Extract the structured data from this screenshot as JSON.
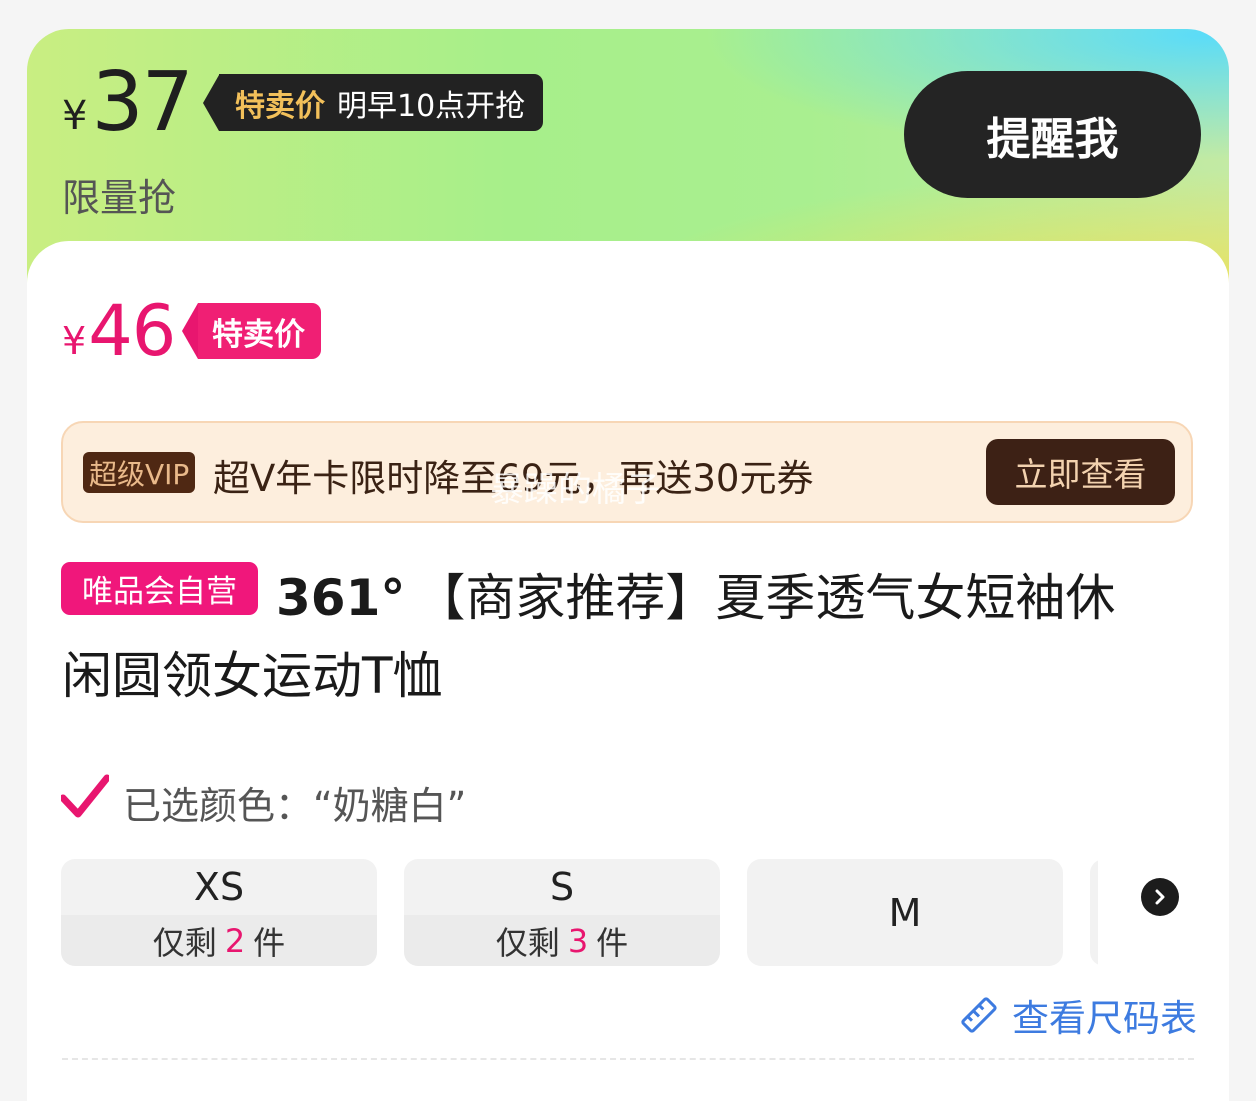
{
  "flash_sale": {
    "currency": "¥",
    "price": "37",
    "tag_label": "特卖价",
    "tag_time": "明早10点开抢",
    "subtitle": "限量抢",
    "remind_button": "提醒我"
  },
  "current_price": {
    "currency": "¥",
    "price": "46",
    "tag_label": "特卖价"
  },
  "vip_banner": {
    "badge": "超级VIP",
    "text": "超V年卡限时降至69元，再送30元券",
    "button": "立即查看"
  },
  "watermark": "暴躁的橘子",
  "product": {
    "shop_badge": "唯品会自营",
    "brand": "361°",
    "title_line1": "【商家推荐】夏季透气女短袖休",
    "title_line2": "闲圆领女运动T恤"
  },
  "selection": {
    "selected_color": "已选颜色：“奶糖白”"
  },
  "sizes": [
    {
      "label": "XS",
      "stock_prefix": "仅剩",
      "stock": "2",
      "stock_suffix": "件"
    },
    {
      "label": "S",
      "stock_prefix": "仅剩",
      "stock": "3",
      "stock_suffix": "件"
    },
    {
      "label": "M"
    }
  ],
  "size_chart_link": "查看尺码表",
  "colors": {
    "accent_pink": "#e8166f",
    "link_blue": "#3d7be0",
    "dark_button": "#242424",
    "vip_brown": "#3d2115"
  },
  "icons": [
    "check-icon",
    "chevron-right-icon",
    "ruler-icon"
  ]
}
